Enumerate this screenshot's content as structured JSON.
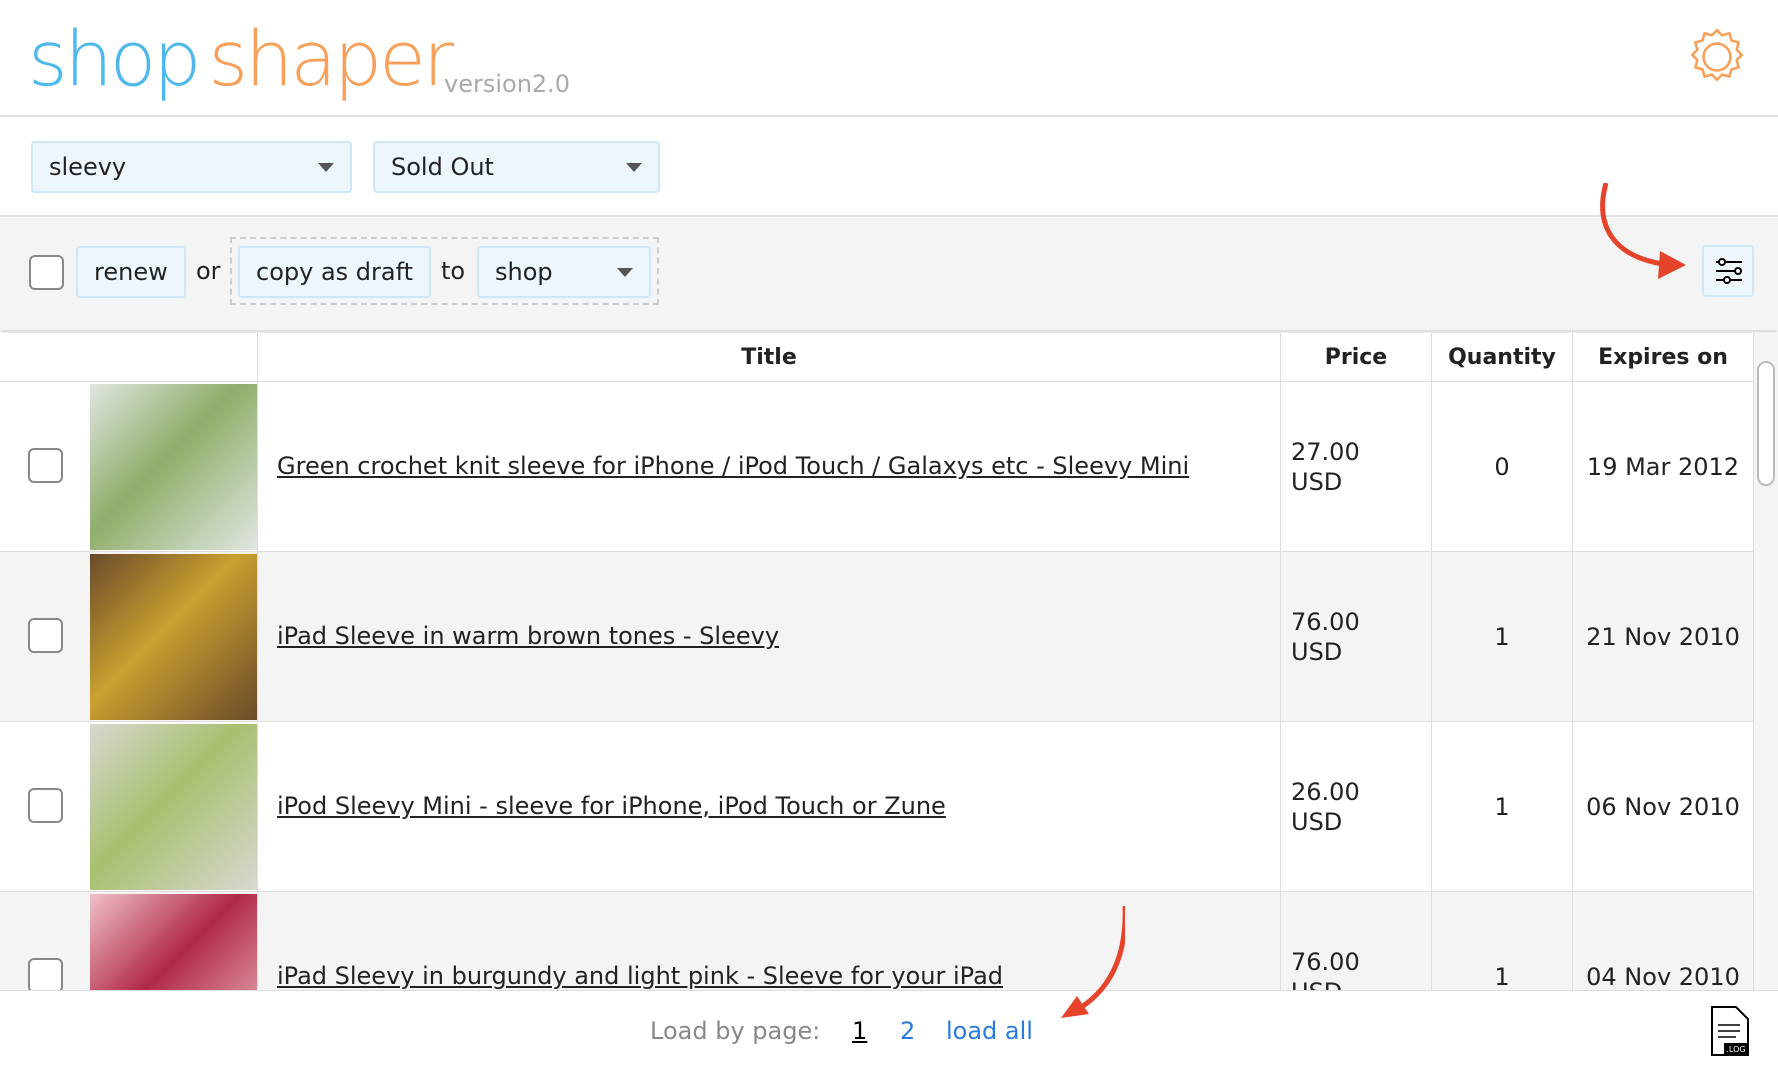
{
  "header": {
    "logo_part1": "shop",
    "logo_part2": "shaper",
    "version": "version2.0",
    "settings_icon": "gear-icon"
  },
  "filters": {
    "shop_select": "sleevy",
    "status_select": "Sold Out"
  },
  "actions": {
    "renew": "renew",
    "or": "or",
    "copy_as_draft": "copy as draft",
    "to": "to",
    "target_select": "shop",
    "columns_icon": "sliders-icon"
  },
  "table": {
    "columns": [
      "Title",
      "Price",
      "Quantity",
      "Expires on"
    ],
    "rows": [
      {
        "title": "Green crochet knit sleeve for iPhone / iPod Touch / Galaxys etc - Sleevy Mini",
        "price": "27.00",
        "currency": "USD",
        "quantity": "0",
        "expires": "19 Mar 2012"
      },
      {
        "title": "iPad Sleeve in warm brown tones - Sleevy",
        "price": "76.00",
        "currency": "USD",
        "quantity": "1",
        "expires": "21 Nov 2010"
      },
      {
        "title": "iPod Sleevy Mini - sleeve for iPhone, iPod Touch or Zune",
        "price": "26.00",
        "currency": "USD",
        "quantity": "1",
        "expires": "06 Nov 2010"
      },
      {
        "title": "iPad Sleevy in burgundy and light pink - Sleeve for your iPad",
        "price": "76.00",
        "currency": "USD",
        "quantity": "1",
        "expires": "04 Nov 2010"
      }
    ]
  },
  "footer": {
    "load_label": "Load by page:",
    "page1": "1",
    "page2": "2",
    "load_all": "load all",
    "log_icon": "log-file-icon"
  },
  "colors": {
    "logo_blue": "#4db8ec",
    "logo_orange": "#f7a05a",
    "link": "#2a7ae2",
    "arrow": "#e5432a"
  }
}
